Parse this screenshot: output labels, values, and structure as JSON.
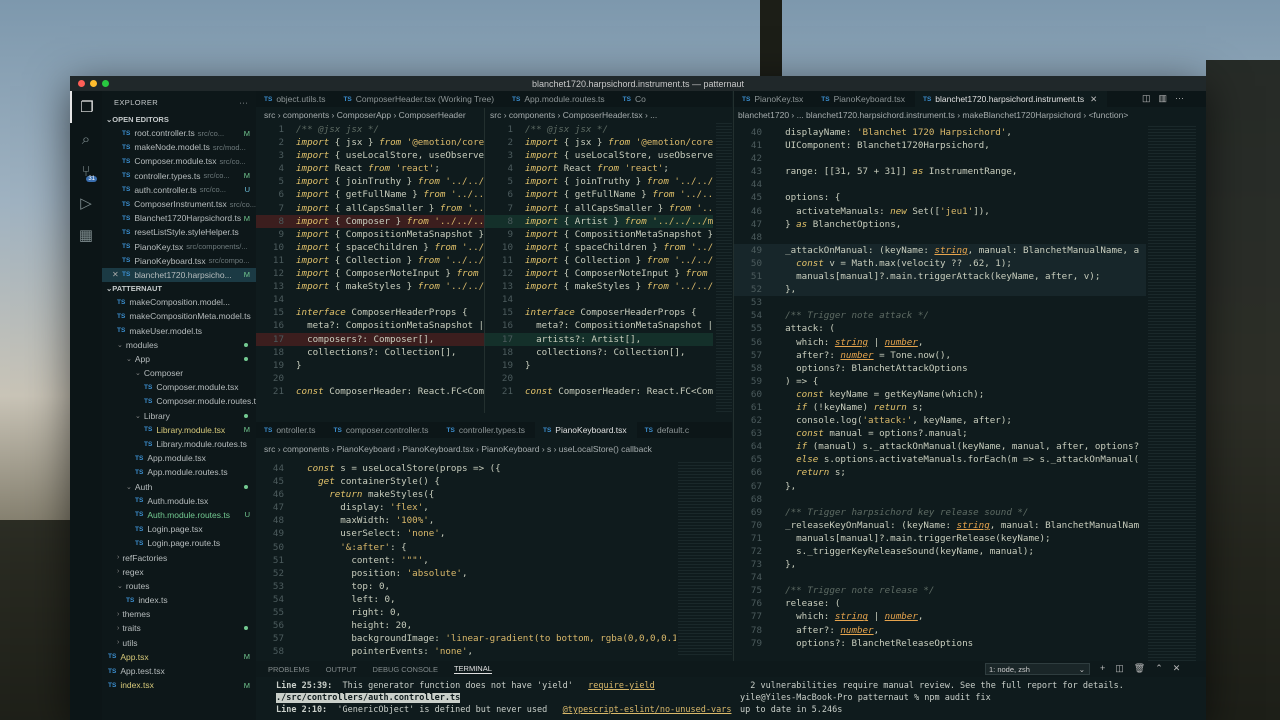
{
  "window": {
    "title": "blanchet1720.harpsichord.instrument.ts — patternaut"
  },
  "activity": {
    "badge": "31"
  },
  "sidebar": {
    "title": "EXPLORER",
    "open_editors_label": "OPEN EDITORS",
    "project_label": "PATTERNAUT",
    "open_editors": [
      {
        "name": "root.controller.ts",
        "path": "src/co...",
        "mark": "M"
      },
      {
        "name": "makeNode.model.ts",
        "path": "src/mod...",
        "mark": ""
      },
      {
        "name": "Composer.module.tsx",
        "path": "src/co...",
        "mark": ""
      },
      {
        "name": "controller.types.ts",
        "path": "src/co...",
        "mark": "M"
      },
      {
        "name": "auth.controller.ts",
        "path": "src/co...",
        "mark": "U"
      },
      {
        "name": "ComposerInstrument.tsx",
        "path": "src/co...",
        "mark": ""
      },
      {
        "name": "Blanchet1720Harpsichord.ts",
        "path": "",
        "mark": "M"
      },
      {
        "name": "resetListStyle.styleHelper.ts",
        "path": "",
        "mark": ""
      },
      {
        "name": "PianoKey.tsx",
        "path": "src/components/...",
        "mark": ""
      },
      {
        "name": "PianoKeyboard.tsx",
        "path": "src/compo...",
        "mark": ""
      },
      {
        "name": "blanchet1720.harpsicho...",
        "path": "",
        "mark": "M"
      }
    ],
    "project": [
      {
        "name": "makeComposition.model...",
        "kind": "ts",
        "indent": 1,
        "mark": ""
      },
      {
        "name": "makeCompositionMeta.model.ts",
        "kind": "ts",
        "indent": 1,
        "mark": ""
      },
      {
        "name": "makeUser.model.ts",
        "kind": "ts",
        "indent": 1,
        "mark": ""
      },
      {
        "name": "modules",
        "kind": "folder-open",
        "indent": 1,
        "mark": "dot"
      },
      {
        "name": "App",
        "kind": "folder-open",
        "indent": 2,
        "mark": "dot"
      },
      {
        "name": "Composer",
        "kind": "folder-open",
        "indent": 3,
        "mark": ""
      },
      {
        "name": "Composer.module.tsx",
        "kind": "file",
        "indent": 4,
        "mark": ""
      },
      {
        "name": "Composer.module.routes.ts",
        "kind": "file",
        "indent": 4,
        "mark": ""
      },
      {
        "name": "Library",
        "kind": "folder-open",
        "indent": 3,
        "mark": "dot"
      },
      {
        "name": "Library.module.tsx",
        "kind": "file",
        "indent": 4,
        "mark": "M"
      },
      {
        "name": "Library.module.routes.ts",
        "kind": "file",
        "indent": 4,
        "mark": ""
      },
      {
        "name": "App.module.tsx",
        "kind": "file",
        "indent": 3,
        "mark": ""
      },
      {
        "name": "App.module.routes.ts",
        "kind": "file",
        "indent": 3,
        "mark": ""
      },
      {
        "name": "Auth",
        "kind": "folder-open",
        "indent": 2,
        "mark": "dot"
      },
      {
        "name": "Auth.module.tsx",
        "kind": "file",
        "indent": 3,
        "mark": ""
      },
      {
        "name": "Auth.module.routes.ts",
        "kind": "file",
        "indent": 3,
        "mark": "U"
      },
      {
        "name": "Login.page.tsx",
        "kind": "file",
        "indent": 3,
        "mark": ""
      },
      {
        "name": "Login.page.route.ts",
        "kind": "file",
        "indent": 3,
        "mark": ""
      },
      {
        "name": "refFactories",
        "kind": "folder",
        "indent": 1,
        "mark": ""
      },
      {
        "name": "regex",
        "kind": "folder",
        "indent": 1,
        "mark": ""
      },
      {
        "name": "routes",
        "kind": "folder-open",
        "indent": 1,
        "mark": ""
      },
      {
        "name": "index.ts",
        "kind": "ts",
        "indent": 2,
        "mark": ""
      },
      {
        "name": "themes",
        "kind": "folder",
        "indent": 1,
        "mark": ""
      },
      {
        "name": "traits",
        "kind": "folder",
        "indent": 1,
        "mark": "dot"
      },
      {
        "name": "utils",
        "kind": "folder",
        "indent": 1,
        "mark": ""
      },
      {
        "name": "App.tsx",
        "kind": "ts",
        "indent": 0,
        "mark": "M"
      },
      {
        "name": "App.test.tsx",
        "kind": "file",
        "indent": 0,
        "mark": ""
      },
      {
        "name": "index.tsx",
        "kind": "ts",
        "indent": 0,
        "mark": "M"
      }
    ]
  },
  "top_tabs_left": [
    {
      "name": "object.utils.ts",
      "active": false
    },
    {
      "name": "ComposerHeader.tsx (Working Tree)",
      "active": false
    },
    {
      "name": "App.module.routes.ts",
      "active": false
    },
    {
      "name": "Co",
      "active": false
    }
  ],
  "top_tabs_right": [
    {
      "name": "PianoKey.tsx",
      "active": false
    },
    {
      "name": "PianoKeyboard.tsx",
      "active": false
    },
    {
      "name": "blanchet1720.harpsichord.instrument.ts",
      "active": true
    }
  ],
  "diff": {
    "breadcrumb_left": "src › components › ComposerApp › ComposerHeader",
    "breadcrumb_right": "src › components › ComposerHeader.tsx › ...",
    "left": [
      {
        "n": "1",
        "h": "",
        "t": "/** @jsx jsx */"
      },
      {
        "n": "2",
        "h": "",
        "t": "import { jsx } from '@emotion/core'"
      },
      {
        "n": "3",
        "h": "",
        "t": "import { useLocalStore, useObserver"
      },
      {
        "n": "4",
        "h": "",
        "t": "import React from 'react';"
      },
      {
        "n": "5",
        "h": "",
        "t": "import { joinTruthy } from '../../.."
      },
      {
        "n": "6",
        "h": "",
        "t": "import { getFullName } from '../../"
      },
      {
        "n": "7",
        "h": "",
        "t": "import { allCapsSmaller } from '../"
      },
      {
        "n": "8",
        "h": "red",
        "t": "import { Composer } from '../../../m"
      },
      {
        "n": "9",
        "h": "",
        "t": "import { CompositionMetaSnapshot } f"
      },
      {
        "n": "10",
        "h": "",
        "t": "import { spaceChildren } from '../.."
      },
      {
        "n": "11",
        "h": "",
        "t": "import { Collection } from '../../.."
      },
      {
        "n": "12",
        "h": "",
        "t": "import { ComposerNoteInput } from '../Co"
      },
      {
        "n": "13",
        "h": "",
        "t": "import { makeStyles } from '../../.."
      },
      {
        "n": "14",
        "h": "",
        "t": ""
      },
      {
        "n": "15",
        "h": "",
        "t": "interface ComposerHeaderProps {"
      },
      {
        "n": "16",
        "h": "",
        "t": "  meta?: CompositionMetaSnapshot | n"
      },
      {
        "n": "17",
        "h": "red",
        "t": "  composers?: Composer[],"
      },
      {
        "n": "18",
        "h": "",
        "t": "  collections?: Collection[],"
      },
      {
        "n": "19",
        "h": "",
        "t": "}"
      },
      {
        "n": "20",
        "h": "",
        "t": ""
      },
      {
        "n": "21",
        "h": "",
        "t": "const ComposerHeader: React.FC<Compo"
      }
    ],
    "right": [
      {
        "n": "1",
        "h": "",
        "t": "/** @jsx jsx */"
      },
      {
        "n": "2",
        "h": "",
        "t": "import { jsx } from '@emotion/core'"
      },
      {
        "n": "3",
        "h": "",
        "t": "import { useLocalStore, useObserver"
      },
      {
        "n": "4",
        "h": "",
        "t": "import React from 'react';"
      },
      {
        "n": "5",
        "h": "",
        "t": "import { joinTruthy } from '../../.."
      },
      {
        "n": "6",
        "h": "",
        "t": "import { getFullName } from '../../"
      },
      {
        "n": "7",
        "h": "",
        "t": "import { allCapsSmaller } from '../.."
      },
      {
        "n": "8",
        "h": "green",
        "t": "import { Artist } from '../../../mod"
      },
      {
        "n": "9",
        "h": "",
        "t": "import { CompositionMetaSnapshot } f"
      },
      {
        "n": "10",
        "h": "",
        "t": "import { spaceChildren } from '../.."
      },
      {
        "n": "11",
        "h": "",
        "t": "import { Collection } from '../../.."
      },
      {
        "n": "12",
        "h": "",
        "t": "import { ComposerNoteInput } from '../Co"
      },
      {
        "n": "13",
        "h": "",
        "t": "import { makeStyles } from '../../.."
      },
      {
        "n": "14",
        "h": "",
        "t": ""
      },
      {
        "n": "15",
        "h": "",
        "t": "interface ComposerHeaderProps {"
      },
      {
        "n": "16",
        "h": "",
        "t": "  meta?: CompositionMetaSnapshot | n"
      },
      {
        "n": "17",
        "h": "green",
        "t": "  artists?: Artist[],"
      },
      {
        "n": "18",
        "h": "",
        "t": "  collections?: Collection[],"
      },
      {
        "n": "19",
        "h": "",
        "t": "}"
      },
      {
        "n": "20",
        "h": "",
        "t": ""
      },
      {
        "n": "21",
        "h": "",
        "t": "const ComposerHeader: React.FC<Compo"
      }
    ]
  },
  "bottom_tabs": [
    {
      "name": "ontroller.ts",
      "active": false
    },
    {
      "name": "composer.controller.ts",
      "active": false
    },
    {
      "name": "controller.types.ts",
      "active": false
    },
    {
      "name": "PianoKeyboard.tsx",
      "active": true
    },
    {
      "name": "default.c",
      "active": false
    }
  ],
  "piano": {
    "breadcrumb": "src › components › PianoKeyboard › PianoKeyboard.tsx › PianoKeyboard › s › useLocalStore() callback",
    "lines": [
      {
        "n": "44",
        "t": "  const s = useLocalStore(props => ({"
      },
      {
        "n": "45",
        "t": "    get containerStyle() {"
      },
      {
        "n": "46",
        "t": "      return makeStyles({"
      },
      {
        "n": "47",
        "t": "        display: 'flex',"
      },
      {
        "n": "48",
        "t": "        maxWidth: '100%',"
      },
      {
        "n": "49",
        "t": "        userSelect: 'none',"
      },
      {
        "n": "50",
        "t": "        '&:after': {"
      },
      {
        "n": "51",
        "t": "          content: '\"\"',"
      },
      {
        "n": "52",
        "t": "          position: 'absolute',"
      },
      {
        "n": "53",
        "t": "          top: 0,"
      },
      {
        "n": "54",
        "t": "          left: 0,"
      },
      {
        "n": "55",
        "t": "          right: 0,"
      },
      {
        "n": "56",
        "t": "          height: 20,"
      },
      {
        "n": "57",
        "t": "          backgroundImage: 'linear-gradient(to bottom, rgba(0,0,0,0.1)"
      },
      {
        "n": "58",
        "t": "          pointerEvents: 'none',"
      }
    ]
  },
  "main": {
    "breadcrumb": "blanchet1720 › ... blanchet1720.harpsichord.instrument.ts › makeBlanchet1720Harpsichord › <function>",
    "lines": [
      {
        "n": "40",
        "h": "",
        "t": "  displayName: 'Blanchet 1720 Harpsichord',"
      },
      {
        "n": "41",
        "h": "",
        "t": "  UIComponent: Blanchet1720Harpsichord,"
      },
      {
        "n": "42",
        "h": "",
        "t": ""
      },
      {
        "n": "43",
        "h": "",
        "t": "  range: [[31, 57 + 31]] as InstrumentRange,"
      },
      {
        "n": "44",
        "h": "",
        "t": ""
      },
      {
        "n": "45",
        "h": "",
        "t": "  options: {"
      },
      {
        "n": "46",
        "h": "",
        "t": "    activateManuals: new Set(['jeu1']),"
      },
      {
        "n": "47",
        "h": "",
        "t": "  } as BlanchetOptions,"
      },
      {
        "n": "48",
        "h": "",
        "t": ""
      },
      {
        "n": "49",
        "h": "cur",
        "t": "  _attackOnManual: (keyName: string, manual: BlanchetManualName, a"
      },
      {
        "n": "50",
        "h": "cur",
        "t": "    const v = Math.max(velocity ?? .62, 1);"
      },
      {
        "n": "51",
        "h": "cur",
        "t": "    manuals[manual]?.main.triggerAttack(keyName, after, v);"
      },
      {
        "n": "52",
        "h": "cur",
        "t": "  },"
      },
      {
        "n": "53",
        "h": "",
        "t": ""
      },
      {
        "n": "54",
        "h": "",
        "t": "  /** Trigger note attack */"
      },
      {
        "n": "55",
        "h": "",
        "t": "  attack: ("
      },
      {
        "n": "56",
        "h": "",
        "t": "    which: string | number,"
      },
      {
        "n": "57",
        "h": "",
        "t": "    after?: number = Tone.now(),"
      },
      {
        "n": "58",
        "h": "",
        "t": "    options?: BlanchetAttackOptions"
      },
      {
        "n": "59",
        "h": "",
        "t": "  ) => {"
      },
      {
        "n": "60",
        "h": "",
        "t": "    const keyName = getKeyName(which);"
      },
      {
        "n": "61",
        "h": "",
        "t": "    if (!keyName) return s;"
      },
      {
        "n": "62",
        "h": "",
        "t": "    console.log('attack:', keyName, after);"
      },
      {
        "n": "63",
        "h": "",
        "t": "    const manual = options?.manual;"
      },
      {
        "n": "64",
        "h": "",
        "t": "    if (manual) s._attackOnManual(keyName, manual, after, options?"
      },
      {
        "n": "65",
        "h": "",
        "t": "    else s.options.activateManuals.forEach(m => s._attackOnManual("
      },
      {
        "n": "66",
        "h": "",
        "t": "    return s;"
      },
      {
        "n": "67",
        "h": "",
        "t": "  },"
      },
      {
        "n": "68",
        "h": "",
        "t": ""
      },
      {
        "n": "69",
        "h": "",
        "t": "  /** Trigger harpsichord key release sound */"
      },
      {
        "n": "70",
        "h": "",
        "t": "  _releaseKeyOnManual: (keyName: string, manual: BlanchetManualNam"
      },
      {
        "n": "71",
        "h": "",
        "t": "    manuals[manual]?.main.triggerRelease(keyName);"
      },
      {
        "n": "72",
        "h": "",
        "t": "    s._triggerKeyReleaseSound(keyName, manual);"
      },
      {
        "n": "73",
        "h": "",
        "t": "  },"
      },
      {
        "n": "74",
        "h": "",
        "t": ""
      },
      {
        "n": "75",
        "h": "",
        "t": "  /** Trigger note release */"
      },
      {
        "n": "76",
        "h": "",
        "t": "  release: ("
      },
      {
        "n": "77",
        "h": "",
        "t": "    which: string | number,"
      },
      {
        "n": "78",
        "h": "",
        "t": "    after?: number,"
      },
      {
        "n": "79",
        "h": "",
        "t": "    options?: BlanchetReleaseOptions"
      }
    ]
  },
  "panel": {
    "tabs": [
      "PROBLEMS",
      "OUTPUT",
      "DEBUG CONSOLE",
      "TERMINAL"
    ],
    "active_tab": "TERMINAL",
    "terminal_select": "1: node, zsh",
    "problems": [
      {
        "loc": "Line 25:39:",
        "msg": "This generator function does not have 'yield'",
        "rule": "require-yield"
      },
      {
        "loc": "./src/controllers/auth.controller.ts",
        "msg": "",
        "rule": ""
      },
      {
        "loc": "Line 2:10:",
        "msg": "'GenericObject' is defined but never used",
        "rule": "@typescript-eslint/no-unused-vars"
      }
    ],
    "terminal": [
      "  2 vulnerabilities require manual review. See the full report for details.",
      "yile@Yiles-MacBook-Pro patternaut % npm audit fix",
      "up to date in 5.246s"
    ]
  }
}
